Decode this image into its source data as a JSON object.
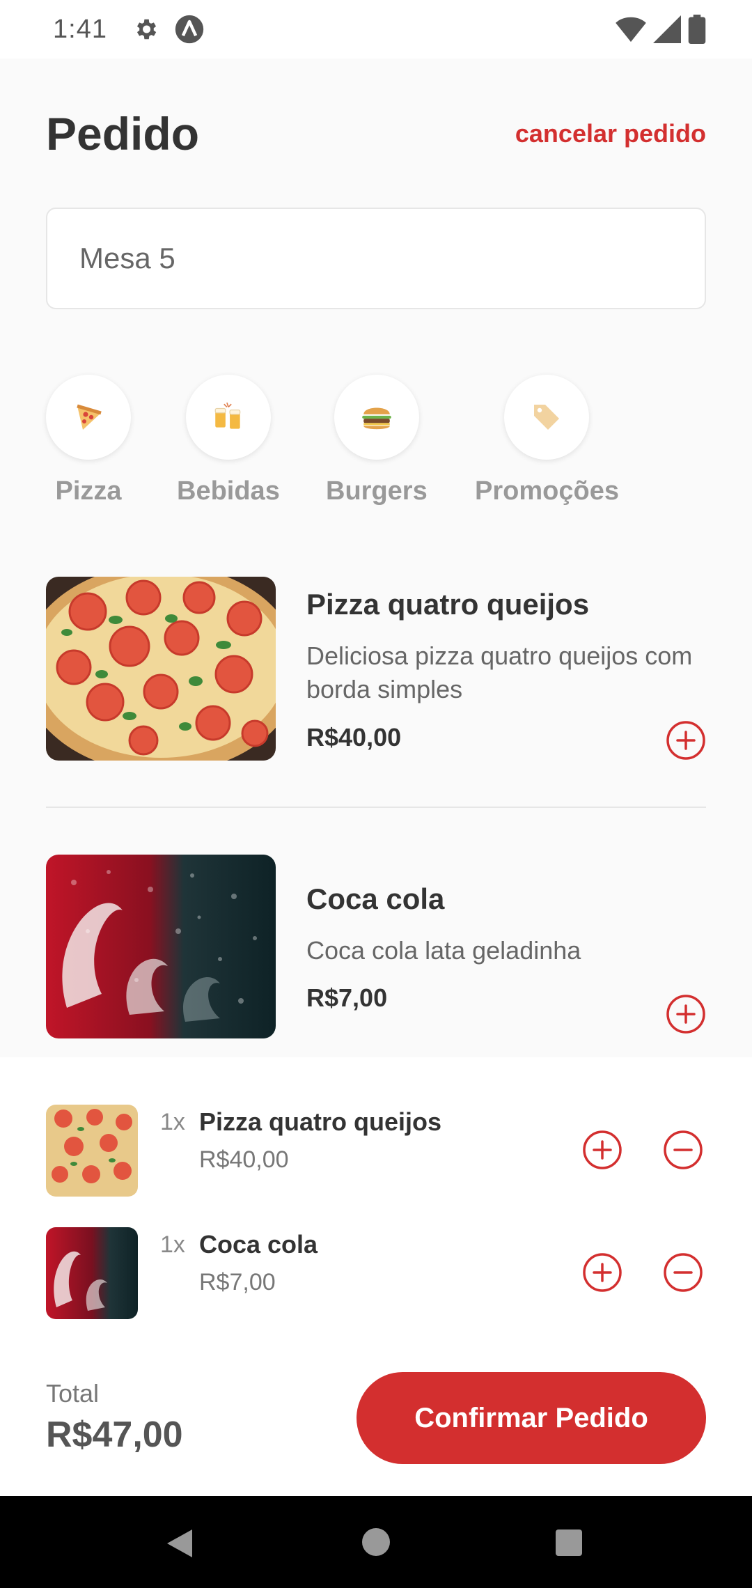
{
  "status_bar": {
    "time": "1:41",
    "icons": [
      "gear-icon",
      "app-a-icon",
      "wifi-icon",
      "signal-icon",
      "battery-icon"
    ]
  },
  "header": {
    "title": "Pedido",
    "cancel_label": "cancelar pedido"
  },
  "table_input": {
    "value": "Mesa 5"
  },
  "categories": [
    {
      "label": "Pizza",
      "icon": "pizza-icon"
    },
    {
      "label": "Bebidas",
      "icon": "beer-icon"
    },
    {
      "label": "Burgers",
      "icon": "burger-icon"
    },
    {
      "label": "Promoções",
      "icon": "tag-icon"
    }
  ],
  "products": [
    {
      "name": "Pizza quatro queijos",
      "description": "Deliciosa pizza quatro queijos com borda simples",
      "price": "R$40,00"
    },
    {
      "name": "Coca cola",
      "description": "Coca cola lata geladinha",
      "price": "R$7,00"
    }
  ],
  "cart": {
    "items": [
      {
        "quantity": "1x",
        "name": "Pizza quatro queijos",
        "price": "R$40,00"
      },
      {
        "quantity": "1x",
        "name": "Coca cola",
        "price": "R$7,00"
      }
    ],
    "total_label": "Total",
    "total_value": "R$47,00",
    "confirm_label": "Confirmar Pedido"
  },
  "colors": {
    "accent": "#d32f2f",
    "background": "#fafafa",
    "text": "#333333"
  }
}
